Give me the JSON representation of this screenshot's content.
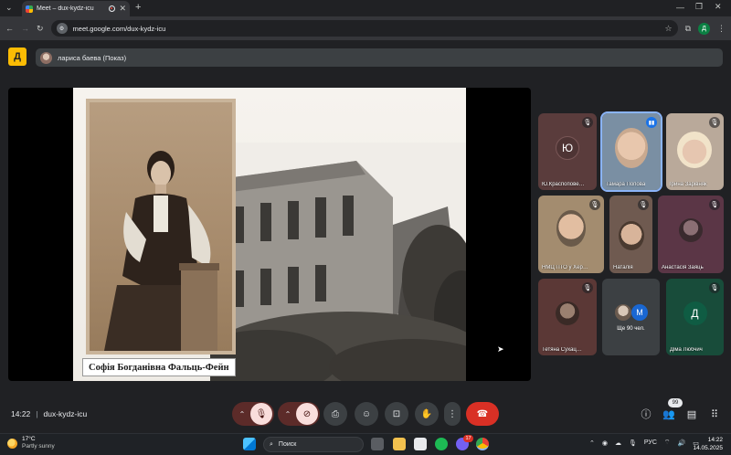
{
  "browser": {
    "tab_title": "Meet – dux-kydz-icu",
    "url": "meet.google.com/dux-kydz-icu",
    "profile_initial": "Д",
    "colors": {
      "accent": "#1a73e8",
      "end_call": "#d93025"
    }
  },
  "meet": {
    "presenter_label": "лариса баева (Показ)",
    "slide_caption": "Софія Богданівна Фальць-Фейн",
    "meeting_time": "14:22",
    "meeting_code": "dux-kydz-icu",
    "participant_count": "99",
    "participants": [
      {
        "name": "Ю.Краспопове…",
        "initial": "Ю"
      },
      {
        "name": "Тамара Попова",
        "initial": ""
      },
      {
        "name": "Ірина Зарівняк",
        "initial": ""
      },
      {
        "name": "НМЦ ПТО у Хер…",
        "initial": ""
      },
      {
        "name": "Наталія",
        "initial": ""
      },
      {
        "name": "Анастасія Заяць",
        "initial": ""
      },
      {
        "name": "Тетяна Сухац…",
        "initial": ""
      },
      {
        "name": "Ще 90 чел.",
        "initial": "M"
      },
      {
        "name": "Діма Любчич",
        "initial": "Д"
      }
    ]
  },
  "taskbar": {
    "weather_temp": "17°C",
    "weather_desc": "Partly sunny",
    "search_placeholder": "Поиск",
    "language": "РУС",
    "clock_time": "14:22",
    "clock_date": "14.05.2025",
    "notification_count": "17"
  }
}
